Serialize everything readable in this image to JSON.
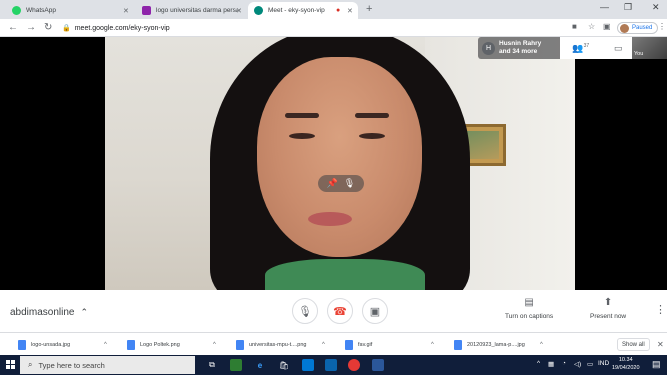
{
  "browser": {
    "tabs": [
      {
        "label": "WhatsApp",
        "icon": "whatsapp-icon",
        "color": "#25d366",
        "active": false
      },
      {
        "label": "logo universitas darma persada",
        "icon": "image-icon",
        "color": "#8e24aa",
        "active": false
      },
      {
        "label": "Meet - eky-syon-vip",
        "icon": "meet-icon",
        "color": "#00897b",
        "active": true
      }
    ],
    "new_tab_glyph": "+",
    "url": "meet.google.com/eky-syon-vip",
    "profile_status": "Paused"
  },
  "meet": {
    "participant_avatar_initial": "H",
    "participant_name": "Husnin Rahry",
    "participant_more": "and 34 more",
    "participant_count": "37",
    "self_label": "You",
    "meeting_name": "abdimasonline",
    "captions_label": "Turn on captions",
    "present_label": "Present now"
  },
  "downloads": [
    {
      "name": "logo-unsada.jpg"
    },
    {
      "name": "Logo Poltek.png"
    },
    {
      "name": "universitas-mpu-t....png"
    },
    {
      "name": "fav.gif"
    },
    {
      "name": "20120923_lama-p....jpg"
    }
  ],
  "downloads_show_all": "Show all",
  "taskbar": {
    "search_placeholder": "Type here to search",
    "lang": "IND",
    "time": "10.34",
    "date": "19/04/2020"
  },
  "colors": {
    "accent": "#1a73e8",
    "end_call": "#ea4335",
    "taskbar": "#101e3a"
  }
}
